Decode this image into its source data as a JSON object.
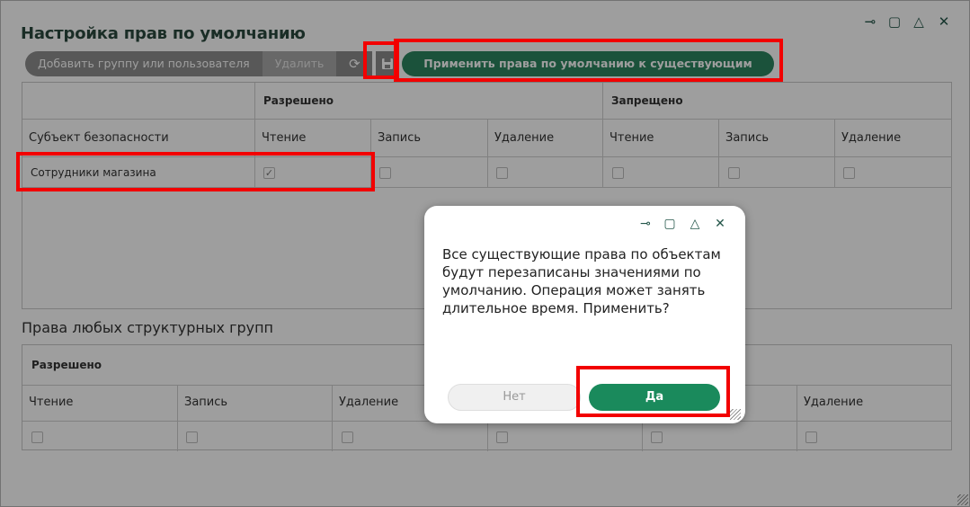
{
  "window": {
    "title": "Настройка прав по умолчанию",
    "controls": [
      "pin-icon",
      "maximize-icon",
      "collapse-icon",
      "close-icon"
    ]
  },
  "toolbar": {
    "add_label": "Добавить группу или пользователя",
    "delete_label": "Удалить",
    "refresh_icon": "refresh-icon",
    "save_icon": "save-icon",
    "apply_label": "Применить права по умолчанию к существующим объектам"
  },
  "table1": {
    "group_allowed": "Разрешено",
    "group_denied": "Запрещено",
    "subject_header": "Субъект безопасности",
    "columns": [
      "Чтение",
      "Запись",
      "Удаление",
      "Чтение",
      "Запись",
      "Удаление"
    ],
    "rows": [
      {
        "subject": "Сотрудники магазина",
        "checks": [
          true,
          false,
          false,
          false,
          false,
          false
        ]
      }
    ]
  },
  "table2": {
    "section_title": "Права любых структурных групп",
    "group_allowed": "Разрешено",
    "columns": [
      "Чтение",
      "Запись",
      "Удаление",
      "Удаление"
    ]
  },
  "dialog": {
    "message": "Все существующие права по объектам будут перезаписаны значениями по умолчанию. Операция может занять длительное время. Применить?",
    "no_label": "Нет",
    "yes_label": "Да"
  },
  "colors": {
    "accent": "#1a8a5c",
    "title": "#2b4a3e",
    "highlight": "#f20000"
  }
}
